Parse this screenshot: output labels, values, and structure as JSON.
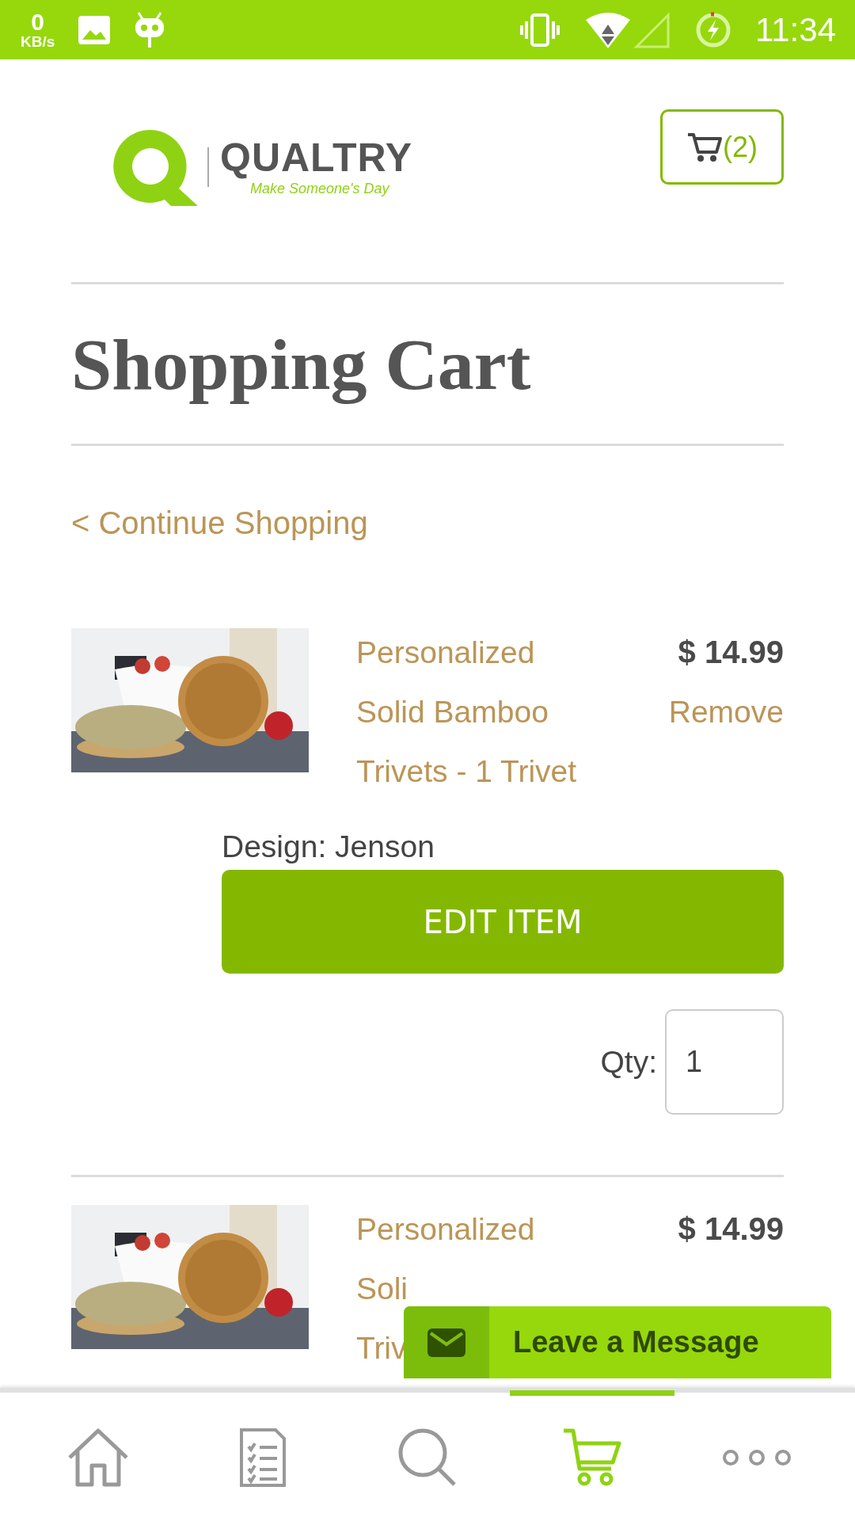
{
  "status_bar": {
    "speed_value": "0",
    "speed_unit": "KB/s",
    "time": "11:34"
  },
  "header": {
    "logo_name": "QUALTRY",
    "logo_tagline": "Make Someone's Day",
    "cart_count": "(2)"
  },
  "title": "Shopping Cart",
  "continue_link": "< Continue Shopping",
  "items": [
    {
      "name_lines": [
        "Personalized",
        "Solid Bamboo",
        "Trivets - 1 Trivet"
      ],
      "price": "$ 14.99",
      "remove": "Remove",
      "design": "Design: Jenson",
      "edit_button": "EDIT ITEM",
      "qty_label": "Qty:",
      "qty": "1"
    },
    {
      "name_lines": [
        "Personalized",
        "Soli",
        "Triv"
      ],
      "price": "$ 14.99"
    }
  ],
  "message_widget": {
    "label": "Leave a Message"
  },
  "bottom_nav": [
    {
      "kind": "home",
      "selected": false
    },
    {
      "kind": "list",
      "selected": false
    },
    {
      "kind": "search",
      "selected": false
    },
    {
      "kind": "cart",
      "selected": true
    },
    {
      "kind": "more",
      "selected": false
    }
  ]
}
